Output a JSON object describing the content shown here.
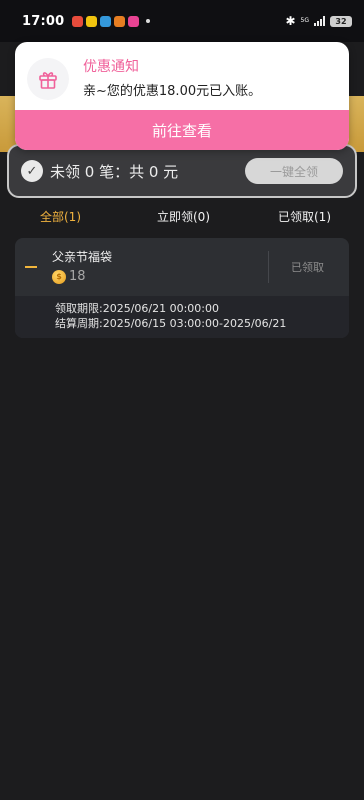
{
  "status_bar": {
    "time": "17:00",
    "network_tag": "5G",
    "battery": "32",
    "app_icon_colors": [
      "#e74c3c",
      "#f1c40f",
      "#3498db",
      "#e67e22",
      "#e84393"
    ]
  },
  "notification": {
    "icon": "gift-icon",
    "title": "优惠通知",
    "body": "亲~您的优惠18.00元已入账。",
    "button_label": "前往查看",
    "accent_color": "#f66fa6"
  },
  "summary": {
    "text": "未领 0 笔：共 0 元",
    "claim_all_label": "一键全领"
  },
  "tabs": [
    {
      "label": "全部(1)",
      "active": true
    },
    {
      "label": "立即领(0)",
      "active": false
    },
    {
      "label": "已领取(1)",
      "active": false
    }
  ],
  "coupon": {
    "title": "父亲节福袋",
    "coin_value": "18",
    "status": "已领取",
    "claim_period": "领取期限:2025/06/21 00:00:00",
    "settlement_period": "结算周期:2025/06/15 03:00:00-2025/06/21"
  }
}
